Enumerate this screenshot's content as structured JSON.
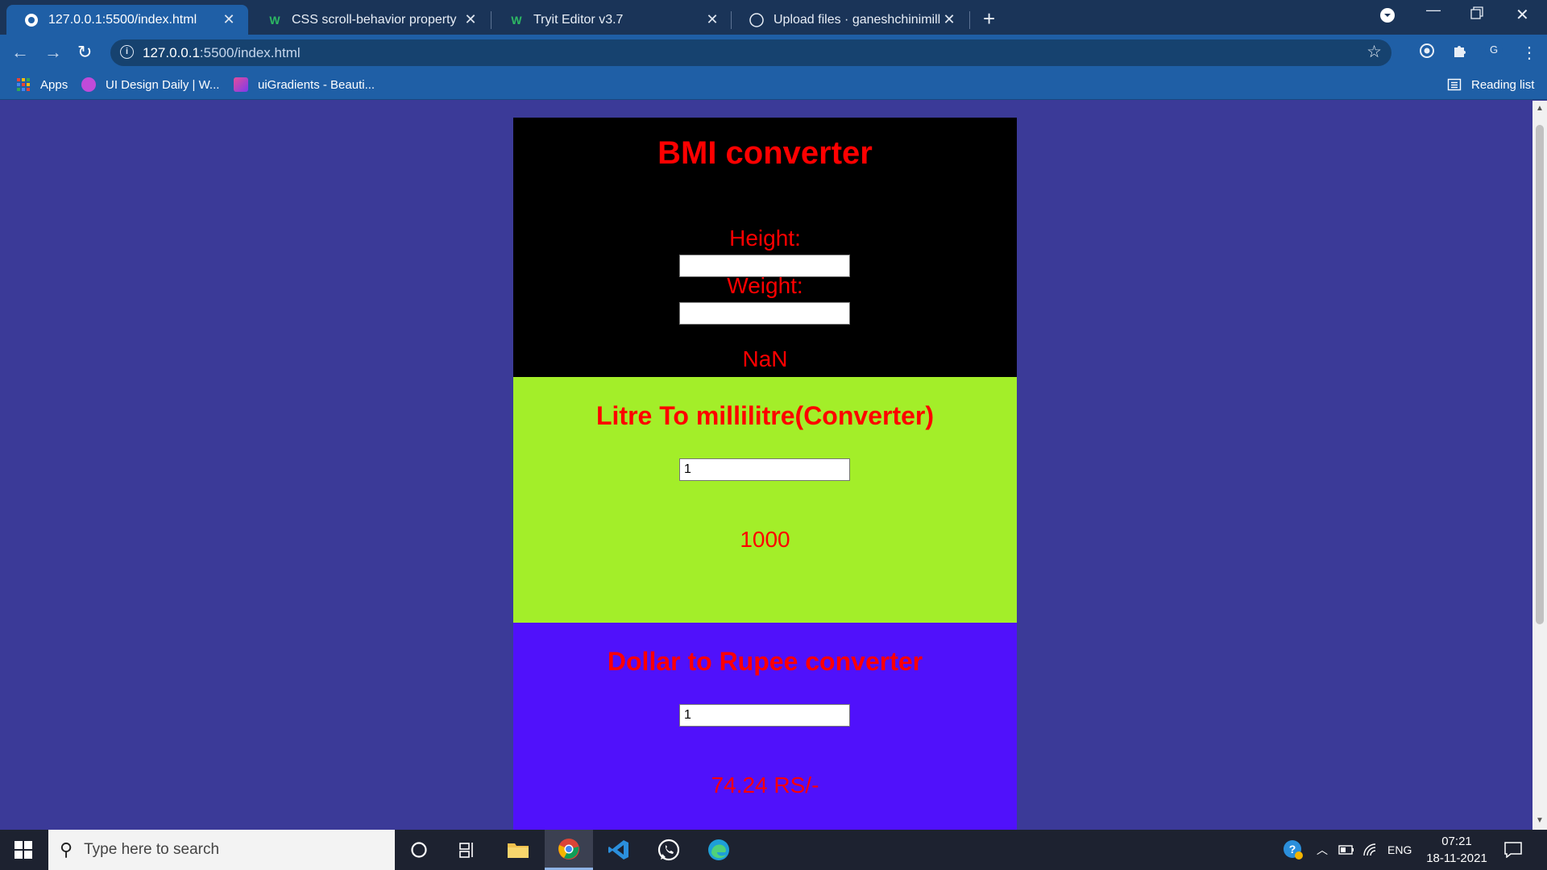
{
  "browser": {
    "tabs": [
      {
        "title": "127.0.0.1:5500/index.html",
        "favicon": "globe-icon",
        "active": true
      },
      {
        "title": "CSS scroll-behavior property",
        "favicon": "w3schools-icon",
        "active": false
      },
      {
        "title": "Tryit Editor v3.7",
        "favicon": "w3schools-icon",
        "active": false
      },
      {
        "title": "Upload files · ganeshchinimilli/an",
        "favicon": "github-icon",
        "active": false
      }
    ],
    "url_host": "127.0.0.1",
    "url_rest": ":5500/index.html",
    "bookmarks": [
      {
        "label": "Apps",
        "icon": "apps-grid-icon"
      },
      {
        "label": "UI Design Daily | W...",
        "icon": "ui-design-daily-icon"
      },
      {
        "label": "uiGradients - Beauti...",
        "icon": "uigradients-icon"
      }
    ],
    "reading_list": "Reading list",
    "profile_initial": "G"
  },
  "page": {
    "bmi": {
      "title": "BMI converter",
      "height_label": "Height:",
      "height_value": "",
      "weight_label": "Weight:",
      "weight_value": "",
      "result": "NaN"
    },
    "litre": {
      "title": "Litre To millilitre(Converter)",
      "input_value": "1",
      "result": "1000"
    },
    "dollar": {
      "title": "Dollar to Rupee converter",
      "input_value": "1",
      "result": "74.24 RS/-"
    },
    "colors": {
      "page_bg": "#3b3a98",
      "bmi_bg": "#000000",
      "litre_bg": "#a3ee29",
      "dollar_bg": "#5011fb",
      "text": "#ff0000"
    }
  },
  "taskbar": {
    "search_placeholder": "Type here to search",
    "language": "ENG",
    "time": "07:21",
    "date": "18-11-2021"
  }
}
